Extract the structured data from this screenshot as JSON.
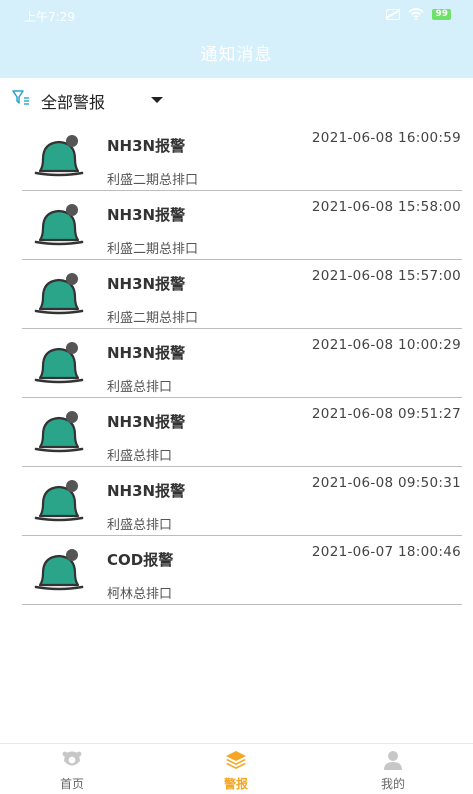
{
  "status": {
    "time": "上午7:29",
    "battery": "99"
  },
  "header": {
    "title": "通知消息"
  },
  "filter": {
    "label": "全部警报"
  },
  "alerts": [
    {
      "title": "NH3N报警",
      "time": "2021-06-08 16:00:59",
      "source": "利盛二期总排口"
    },
    {
      "title": "NH3N报警",
      "time": "2021-06-08 15:58:00",
      "source": "利盛二期总排口"
    },
    {
      "title": "NH3N报警",
      "time": "2021-06-08 15:57:00",
      "source": "利盛二期总排口"
    },
    {
      "title": "NH3N报警",
      "time": "2021-06-08 10:00:29",
      "source": "利盛总排口"
    },
    {
      "title": "NH3N报警",
      "time": "2021-06-08 09:51:27",
      "source": "利盛总排口"
    },
    {
      "title": "NH3N报警",
      "time": "2021-06-08 09:50:31",
      "source": "利盛总排口"
    },
    {
      "title": "COD报警",
      "time": "2021-06-07 18:00:46",
      "source": "柯林总排口"
    }
  ],
  "tabs": [
    {
      "label": "首页",
      "icon": "home-icon"
    },
    {
      "label": "警报",
      "icon": "layers-icon",
      "active": true
    },
    {
      "label": "我的",
      "icon": "user-icon"
    }
  ],
  "colors": {
    "header_bg": "#d6f0fb",
    "bell": "#2aa58a",
    "active_tab": "#f5a623"
  }
}
